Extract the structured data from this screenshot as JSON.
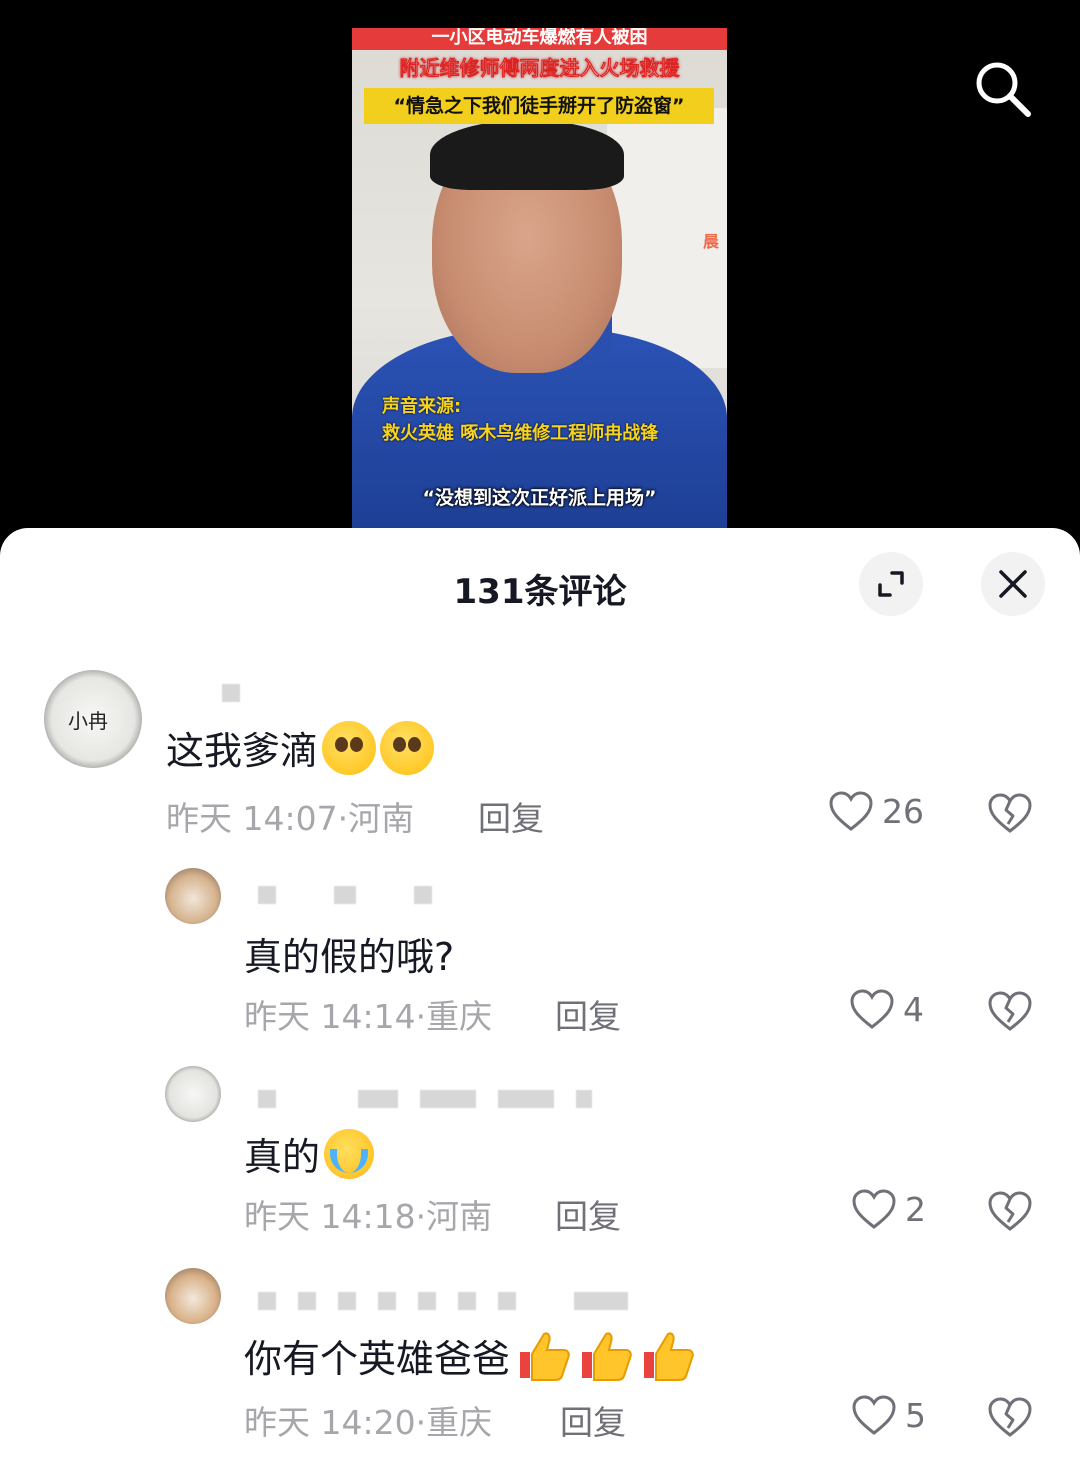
{
  "video": {
    "headline_1": "一小区电动车爆燃有人被困",
    "headline_2": "附近维修师傅两度进入火场救援",
    "headline_3": "“情急之下我们徒手掰开了防盗窗”",
    "caption_label": "声音来源:",
    "caption_source": "救火英雄 啄木鸟维修工程师冉战锋",
    "caption_quote": "“没想到这次正好派上用场”",
    "watermark": "晨"
  },
  "icons": {
    "search": "search-icon",
    "expand": "expand-icon",
    "close": "close-icon",
    "like": "heart-icon",
    "dislike": "broken-heart-icon"
  },
  "sheet": {
    "title": "131条评论"
  },
  "comments": [
    {
      "text": "这我爹滴",
      "emojis": [
        "pleading-face",
        "pleading-face"
      ],
      "time": "昨天 14:07",
      "location": "河南",
      "reply_label": "回复",
      "likes": "26"
    },
    {
      "text": "真的假的哦?",
      "emojis": [],
      "time": "昨天 14:14",
      "location": "重庆",
      "reply_label": "回复",
      "likes": "4"
    },
    {
      "text": "真的",
      "emojis": [
        "loudly-crying-face"
      ],
      "time": "昨天 14:18",
      "location": "河南",
      "reply_label": "回复",
      "likes": "2"
    },
    {
      "text": "你有个英雄爸爸",
      "emojis": [
        "thumbs-up",
        "thumbs-up",
        "thumbs-up"
      ],
      "time": "昨天 14:20",
      "location": "重庆",
      "reply_label": "回复",
      "likes": "5"
    }
  ],
  "meta_separator": "·",
  "colors": {
    "background": "#000000",
    "sheet": "#ffffff",
    "text": "#161823",
    "secondary": "#a7a7ab"
  }
}
